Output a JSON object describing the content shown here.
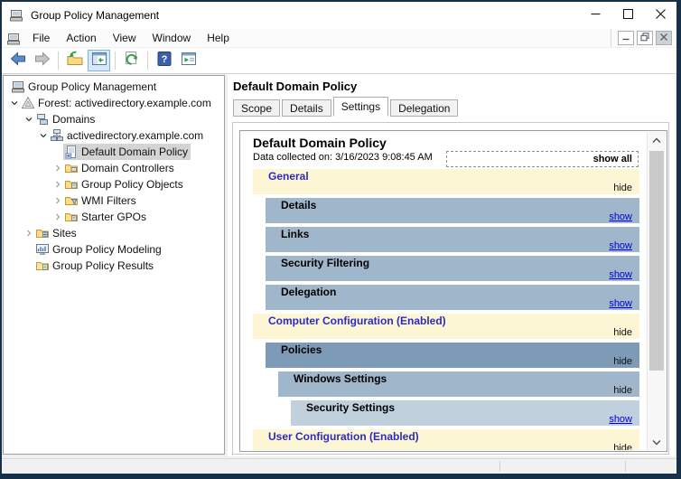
{
  "colors": {
    "window_border": "#16304A",
    "band_yellow": "#FCF6D5",
    "band_blue": "#A0B6CA",
    "band_blue_dark": "#7D9BB7",
    "band_blue_light": "#C0D0DD",
    "heading_blue": "#2B2BC2",
    "link_blue": "#0000D8",
    "hide_text": "#111111",
    "tree_selection": "#D4D4D4",
    "toolbar_active_button": "#D5E8F8"
  },
  "titlebar": {
    "title": "Group Policy Management",
    "controls": [
      {
        "icon": "minimize",
        "name": "minimize-button"
      },
      {
        "icon": "maximize",
        "name": "maximize-button"
      },
      {
        "icon": "close",
        "name": "close-button"
      }
    ]
  },
  "menubar": {
    "items": [
      "File",
      "Action",
      "View",
      "Window",
      "Help"
    ],
    "mdi_controls": [
      {
        "icon": "minimize",
        "name": "child-minimize-button"
      },
      {
        "icon": "restore",
        "name": "child-restore-button"
      },
      {
        "icon": "close",
        "name": "child-close-button"
      }
    ]
  },
  "toolbar": {
    "buttons": [
      {
        "icon": "back",
        "enabled": true
      },
      {
        "icon": "forward",
        "enabled": false
      },
      {
        "icon": "up-one-level",
        "enabled": true
      },
      {
        "icon": "console-tree-toggle",
        "enabled": true,
        "active": true
      },
      {
        "icon": "refresh",
        "enabled": true
      },
      {
        "icon": "help",
        "enabled": true
      },
      {
        "icon": "action-pane-toggle",
        "enabled": true
      }
    ]
  },
  "tree": {
    "items": [
      {
        "label": "Group Policy Management",
        "level": 0,
        "expander": "none",
        "icon": "gpmc-console",
        "selected": false
      },
      {
        "label": "Forest: activedirectory.example.com",
        "level": 1,
        "expander": "expanded",
        "icon": "forest",
        "selected": false
      },
      {
        "label": "Domains",
        "level": 2,
        "expander": "expanded",
        "icon": "domains",
        "selected": false
      },
      {
        "label": "activedirectory.example.com",
        "level": 3,
        "expander": "expanded",
        "icon": "domain",
        "selected": false
      },
      {
        "label": "Default Domain Policy",
        "level": 4,
        "expander": "blank",
        "icon": "gpo-link",
        "selected": true
      },
      {
        "label": "Domain Controllers",
        "level": 4,
        "expander": "collapsed",
        "icon": "folder-dc",
        "selected": false
      },
      {
        "label": "Group Policy Objects",
        "level": 4,
        "expander": "collapsed",
        "icon": "folder-gpo",
        "selected": false
      },
      {
        "label": "WMI Filters",
        "level": 4,
        "expander": "collapsed",
        "icon": "folder-wmi",
        "selected": false
      },
      {
        "label": "Starter GPOs",
        "level": 4,
        "expander": "collapsed",
        "icon": "folder-starter",
        "selected": false
      },
      {
        "label": "Sites",
        "level": 2,
        "expander": "collapsed",
        "icon": "folder-sites",
        "selected": false
      },
      {
        "label": "Group Policy Modeling",
        "level": 2,
        "expander": "blank",
        "icon": "modeling",
        "selected": false
      },
      {
        "label": "Group Policy Results",
        "level": 2,
        "expander": "blank",
        "icon": "results",
        "selected": false
      }
    ]
  },
  "content": {
    "page_title": "Default Domain Policy",
    "tabs": [
      {
        "label": "Scope",
        "active": false
      },
      {
        "label": "Details",
        "active": false
      },
      {
        "label": "Settings",
        "active": true
      },
      {
        "label": "Delegation",
        "active": false
      }
    ],
    "report": {
      "title": "Default Domain Policy",
      "collected": "Data collected on: 3/16/2023 9:08:45 AM",
      "show_all_label": "show all",
      "sections": [
        {
          "title": "General",
          "level": 0,
          "style": "yellow",
          "action": "hide"
        },
        {
          "title": "Details",
          "level": 1,
          "style": "blue",
          "action": "show"
        },
        {
          "title": "Links",
          "level": 1,
          "style": "blue",
          "action": "show"
        },
        {
          "title": "Security Filtering",
          "level": 1,
          "style": "blue",
          "action": "show"
        },
        {
          "title": "Delegation",
          "level": 1,
          "style": "blue",
          "action": "show"
        },
        {
          "title": "Computer Configuration (Enabled)",
          "level": 0,
          "style": "yellow",
          "action": "hide"
        },
        {
          "title": "Policies",
          "level": 1,
          "style": "blue-dark",
          "action": "hide"
        },
        {
          "title": "Windows Settings",
          "level": 2,
          "style": "blue",
          "action": "hide"
        },
        {
          "title": "Security Settings",
          "level": 3,
          "style": "blue-light",
          "action": "show"
        },
        {
          "title": "User Configuration (Enabled)",
          "level": 0,
          "style": "yellow",
          "action": "hide"
        }
      ]
    }
  },
  "statusbar": {
    "text": ""
  }
}
